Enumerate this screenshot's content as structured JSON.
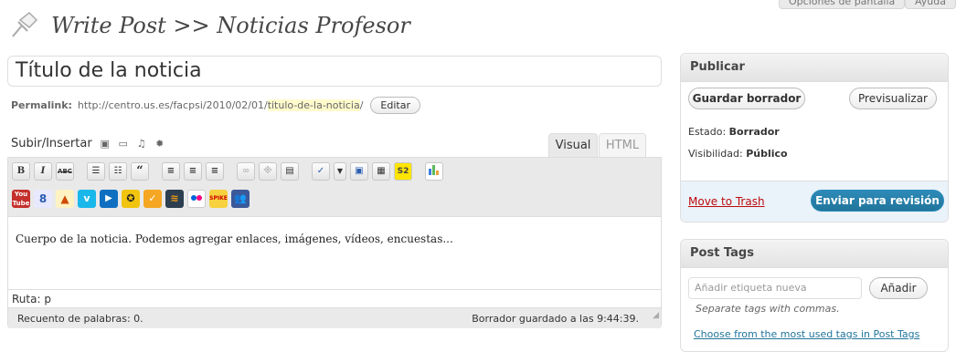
{
  "top_buttons": {
    "screen_options": "Opciones de pantalla",
    "help": "Ayuda"
  },
  "page": {
    "title": "Write Post >> Noticias Profesor"
  },
  "post": {
    "title_value": "Título de la noticia",
    "permalink_label": "Permalink:",
    "permalink_base": "http://centro.us.es/facpsi/2010/02/01/",
    "permalink_slug": "titulo-de-la-noticia",
    "permalink_end": "/",
    "edit_label": "Editar",
    "content": "Cuerpo de la noticia. Podemos agregar enlaces, imágenes, vídeos, encuestas..."
  },
  "editor": {
    "upload_label": "Subir/Insertar",
    "tab_visual": "Visual",
    "tab_html": "HTML",
    "path_label": "Ruta: p",
    "word_count": "Recuento de palabras: 0.",
    "draft_saved": "Borrador guardado a las 9:44:39."
  },
  "toolbar_row1": [
    {
      "name": "bold-button",
      "label": "B"
    },
    {
      "name": "italic-button",
      "label": "I"
    },
    {
      "name": "strikethrough-button",
      "label": "ABC"
    }
  ],
  "publish": {
    "header": "Publicar",
    "save_draft": "Guardar borrador",
    "preview": "Previsualizar",
    "status_label": "Estado:",
    "status_value": "Borrador",
    "visibility_label": "Visibilidad:",
    "visibility_value": "Público",
    "trash": "Move to Trash",
    "submit": "Enviar para revisión"
  },
  "tags": {
    "header": "Post Tags",
    "input_placeholder": "Añadir etiqueta nueva",
    "add": "Añadir",
    "hint": "Separate tags with commas.",
    "choose": "Choose from the most used tags in Post Tags"
  },
  "colors": {
    "accent": "#21759b",
    "trash": "#bc0b0b",
    "slug_highlight": "#fffbcc"
  }
}
